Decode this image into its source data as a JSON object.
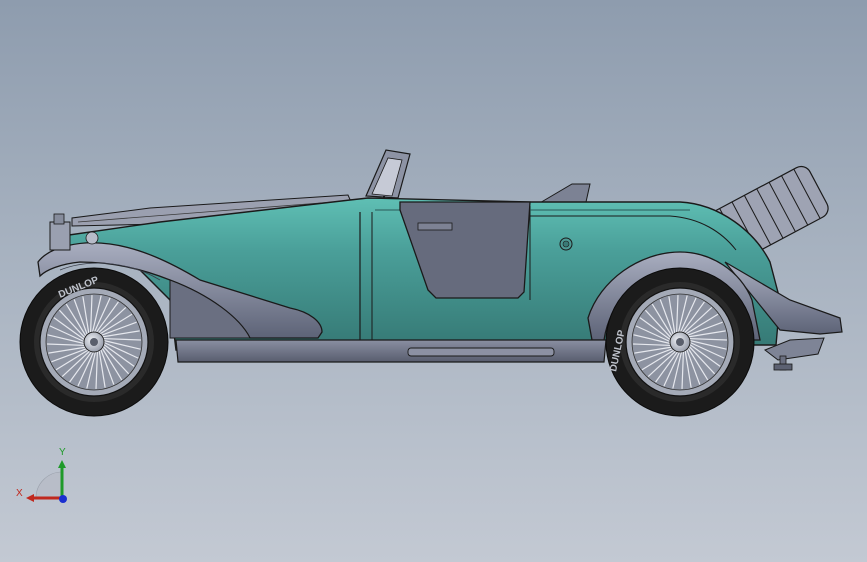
{
  "viewport": {
    "background_top": "#8e9cae",
    "background_bottom": "#c3c9d3"
  },
  "model": {
    "body_color": "#3f8583",
    "body_highlight": "#5fbfb4",
    "fender_color": "#6b7184",
    "fender_light": "#9aa0b2",
    "tire_color": "#1b1b1b",
    "tire_brand": "DUNLOP"
  },
  "triad": {
    "x_label": "X",
    "y_label": "Y",
    "x_color": "#c0281e",
    "y_color": "#1f9a2a",
    "z_color": "#1a2fd0"
  }
}
